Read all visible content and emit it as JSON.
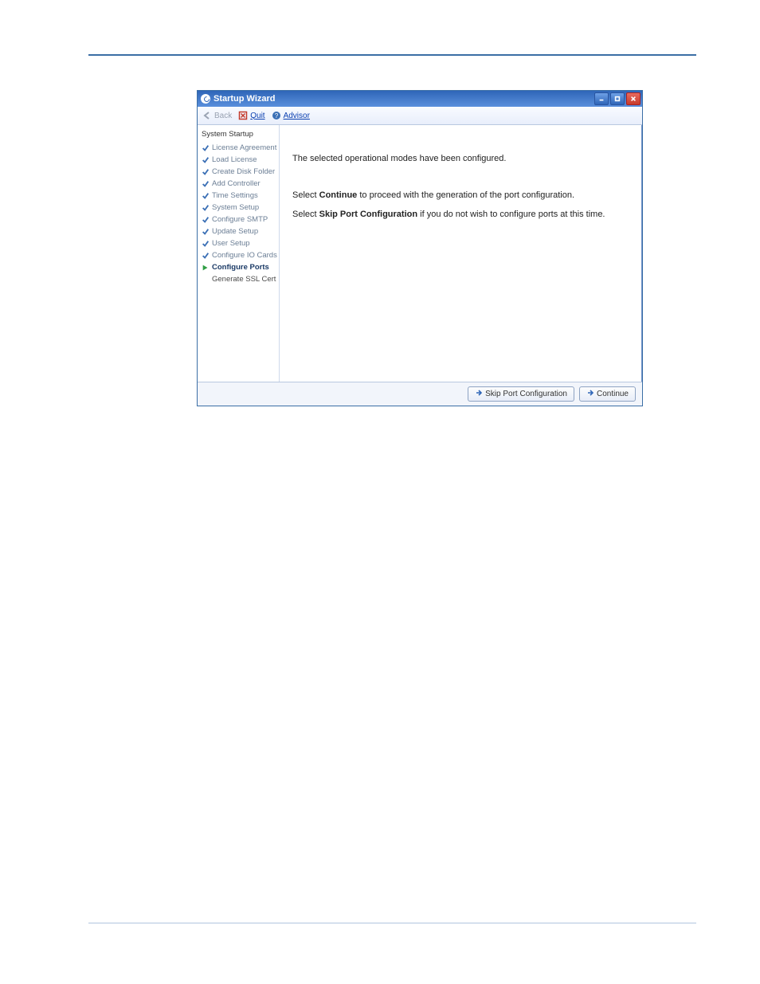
{
  "window": {
    "title": "Startup Wizard"
  },
  "toolbar": {
    "back": "Back",
    "quit": "Quit",
    "advisor": "Advisor"
  },
  "sidebar": {
    "title": "System Startup",
    "steps": [
      {
        "label": "License Agreement",
        "state": "done"
      },
      {
        "label": "Load License",
        "state": "done"
      },
      {
        "label": "Create Disk Folder",
        "state": "done"
      },
      {
        "label": "Add Controller",
        "state": "done"
      },
      {
        "label": "Time Settings",
        "state": "done"
      },
      {
        "label": "System Setup",
        "state": "done"
      },
      {
        "label": "Configure SMTP",
        "state": "done"
      },
      {
        "label": "Update Setup",
        "state": "done"
      },
      {
        "label": "User Setup",
        "state": "done"
      },
      {
        "label": "Configure IO Cards",
        "state": "done"
      },
      {
        "label": "Configure Ports",
        "state": "current"
      },
      {
        "label": "Generate SSL Cert",
        "state": "pending"
      }
    ]
  },
  "content": {
    "line1": "The selected operational modes have been configured.",
    "line2_pre": "Select ",
    "line2_bold": "Continue",
    "line2_post": " to proceed with the generation of the port configuration.",
    "line3_pre": "Select ",
    "line3_bold": "Skip Port Configuration",
    "line3_post": " if you do not wish to configure ports at this time."
  },
  "footer": {
    "skip": "Skip Port Configuration",
    "continue": "Continue"
  }
}
